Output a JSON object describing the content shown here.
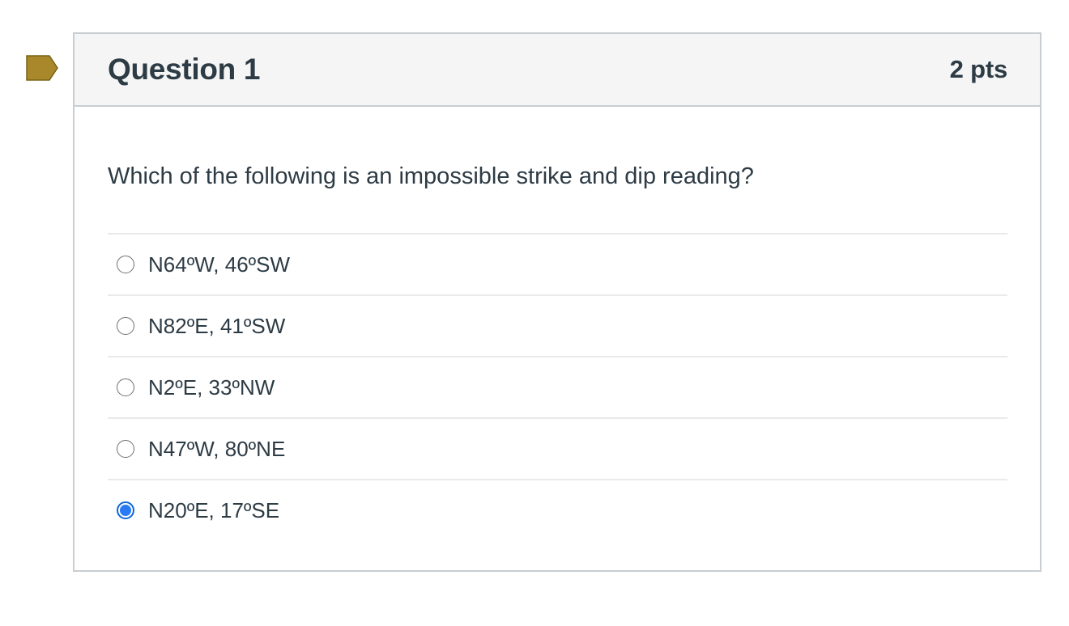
{
  "question": {
    "title": "Question 1",
    "points": "2 pts",
    "text": "Which of the following is an impossible strike and dip reading?",
    "flag_color": "#a8882a",
    "answers": [
      {
        "label": "N64ºW, 46ºSW",
        "selected": false
      },
      {
        "label": "N82ºE, 41ºSW",
        "selected": false
      },
      {
        "label": "N2ºE, 33ºNW",
        "selected": false
      },
      {
        "label": "N47ºW, 80ºNE",
        "selected": false
      },
      {
        "label": "N20ºE, 17ºSE",
        "selected": true
      }
    ]
  },
  "colors": {
    "selected_radio": "#2a7bf2",
    "header_bg": "#f5f5f5",
    "border": "#c7cdd1",
    "text": "#2d3b45"
  }
}
